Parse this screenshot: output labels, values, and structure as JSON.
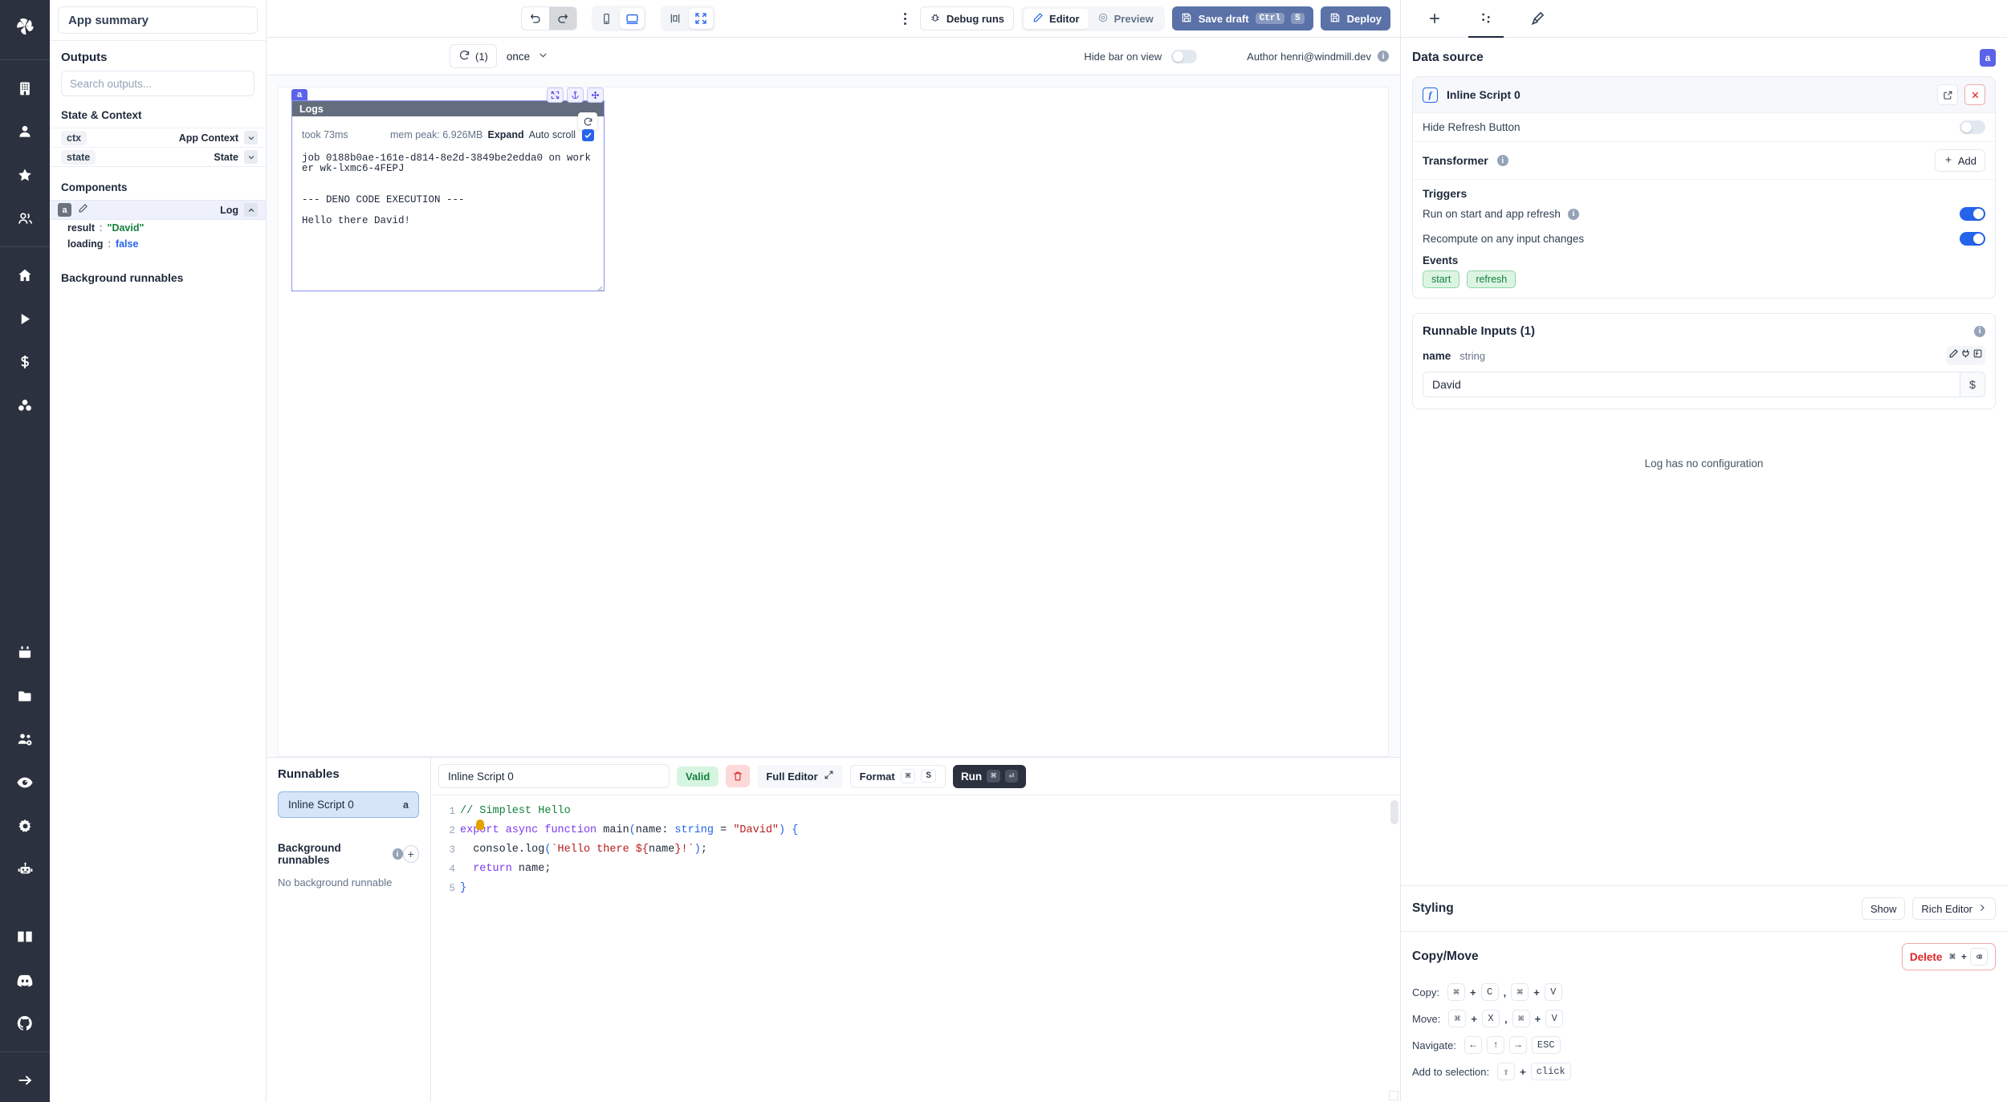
{
  "rail": {
    "logo_icon": "windmill-logo-icon",
    "group1": [
      "building-icon",
      "user-icon",
      "star-icon",
      "users-group-icon"
    ],
    "group2": [
      "home-icon",
      "play-icon",
      "dollar-icon",
      "blocks-icon"
    ],
    "group3": [
      "calendar-icon",
      "folder-icon",
      "team-settings-icon",
      "eye-icon",
      "gear-icon",
      "robot-icon"
    ],
    "group4": [
      "book-icon",
      "discord-icon",
      "github-icon"
    ],
    "footer": [
      "arrow-right-icon"
    ]
  },
  "left_panel": {
    "app_title": "App summary",
    "outputs_heading": "Outputs",
    "search_placeholder": "Search outputs...",
    "search_value": "",
    "state_context_heading": "State & Context",
    "state_rows": [
      {
        "key": "ctx",
        "value": "App Context"
      },
      {
        "key": "state",
        "value": "State"
      }
    ],
    "components_heading": "Components",
    "component": {
      "badge": "a",
      "name": "Log",
      "edit_icon": "pencil-icon",
      "collapse_icon": "chevron-up-icon",
      "outputs": [
        {
          "key": "result",
          "sep": ":",
          "value": "\"David\"",
          "kind": "string"
        },
        {
          "key": "loading",
          "sep": ":",
          "value": "false",
          "kind": "boolean"
        }
      ]
    },
    "background_runnables_heading": "Background runnables"
  },
  "topbar": {
    "undo_icon": "undo-icon",
    "redo_icon": "redo-icon",
    "mobile_icon": "mobile-icon",
    "desktop_icon": "desktop-icon",
    "width_icon": "width-icon",
    "fullscreen_icon": "fullscreen-icon",
    "more_icon": "more-vertical-icon",
    "debug_runs": "Debug runs",
    "debug_icon": "bug-icon",
    "editor": "Editor",
    "editor_icon": "pencil-icon",
    "preview": "Preview",
    "preview_icon": "eye-icon",
    "save_draft": "Save draft",
    "save_icon": "save-icon",
    "save_key1": "Ctrl",
    "save_key2": "S",
    "deploy": "Deploy",
    "deploy_icon": "save-icon"
  },
  "subbar": {
    "refresh_icon": "refresh-icon",
    "refresh_count": "(1)",
    "mode": "once",
    "mode_chevron": "chevron-down-icon",
    "hide_bar_label": "Hide bar on view",
    "hide_bar_on": false,
    "author": "Author henri@windmill.dev",
    "info_icon": "info-icon"
  },
  "logs_card": {
    "badge": "a",
    "title": "Logs",
    "tools": [
      "fullscreen-icon",
      "anchor-icon",
      "move-icon"
    ],
    "refresh_icon": "refresh-icon",
    "took": "took 73ms",
    "mem_peak": "mem peak: 6.926MB",
    "expand": "Expand",
    "auto_scroll": "Auto scroll",
    "auto_scroll_checked": true,
    "checkbox_icon": "check-icon",
    "log_lines": [
      "job 0188b0ae-161e-d814-8e2d-3849be2edda0 on worker wk-lxmc6-4FEPJ",
      "",
      "",
      "--- DENO CODE EXECUTION ---",
      "",
      "Hello there David!"
    ]
  },
  "runnables": {
    "heading": "Runnables",
    "items": [
      {
        "name": "Inline Script 0",
        "badge": "a"
      }
    ],
    "background_heading": "Background runnables",
    "info_icon": "info-icon",
    "add_icon": "plus-icon",
    "empty_text": "No background runnable"
  },
  "editor": {
    "script_name": "Inline Script 0",
    "valid_badge": "Valid",
    "delete_icon": "trash-icon",
    "full_editor": "Full Editor",
    "full_editor_icon": "expand-diagonal-icon",
    "format": "Format",
    "format_key1": "⌘",
    "format_key2": "S",
    "run": "Run",
    "run_key1": "⌘",
    "run_key2": "⏎",
    "line_numbers": [
      "1",
      "2",
      "3",
      "4",
      "5"
    ],
    "code_lines": [
      {
        "n": 1,
        "tokens": [
          {
            "t": "// Simplest Hello",
            "c": "c-cm"
          }
        ]
      },
      {
        "n": 2,
        "tokens": [
          {
            "t": "export",
            "c": "c-kw"
          },
          {
            "t": " ",
            "c": "c-pl"
          },
          {
            "t": "async",
            "c": "c-kw"
          },
          {
            "t": " ",
            "c": "c-pl"
          },
          {
            "t": "function",
            "c": "c-kw"
          },
          {
            "t": " ",
            "c": "c-pl"
          },
          {
            "t": "main",
            "c": "c-fn"
          },
          {
            "t": "(",
            "c": "c-ty"
          },
          {
            "t": "name",
            "c": "c-pl"
          },
          {
            "t": ": ",
            "c": "c-pl"
          },
          {
            "t": "string",
            "c": "c-ty"
          },
          {
            "t": " = ",
            "c": "c-pl"
          },
          {
            "t": "\"David\"",
            "c": "c-st"
          },
          {
            "t": ") {",
            "c": "c-ty"
          }
        ]
      },
      {
        "n": 3,
        "tokens": [
          {
            "t": "  console",
            "c": "c-pl"
          },
          {
            "t": ".",
            "c": "c-pl"
          },
          {
            "t": "log",
            "c": "c-pl"
          },
          {
            "t": "(",
            "c": "c-ty"
          },
          {
            "t": "`Hello there ${",
            "c": "c-st"
          },
          {
            "t": "name",
            "c": "c-pl"
          },
          {
            "t": "}!`",
            "c": "c-st"
          },
          {
            "t": ")",
            "c": "c-ty"
          },
          {
            "t": ";",
            "c": "c-pl"
          }
        ]
      },
      {
        "n": 4,
        "tokens": [
          {
            "t": "  ",
            "c": "c-pl"
          },
          {
            "t": "return",
            "c": "c-kw"
          },
          {
            "t": " name;",
            "c": "c-pl"
          }
        ]
      },
      {
        "n": 5,
        "tokens": [
          {
            "t": "}",
            "c": "c-ty"
          }
        ]
      }
    ]
  },
  "right_panel": {
    "tabs": [
      {
        "icon": "plus-icon",
        "on": false
      },
      {
        "icon": "components-icon",
        "on": true
      },
      {
        "icon": "paintbrush-icon",
        "on": false
      }
    ],
    "data_source": {
      "heading": "Data source",
      "badge": "a",
      "script_name": "Inline Script 0",
      "script_icon": "function-icon",
      "open_icon": "external-link-icon",
      "remove_icon": "x-icon",
      "hide_refresh_label": "Hide Refresh Button",
      "hide_refresh_on": false
    },
    "transformer": {
      "heading": "Transformer",
      "info_icon": "info-icon",
      "add_label": "Add",
      "add_icon": "plus-icon"
    },
    "triggers": {
      "heading": "Triggers",
      "rows": [
        {
          "label": "Run on start and app refresh",
          "info": true,
          "on": true
        },
        {
          "label": "Recompute on any input changes",
          "info": false,
          "on": true
        }
      ],
      "events_label": "Events",
      "events": [
        "start",
        "refresh"
      ]
    },
    "runnable_inputs": {
      "heading": "Runnable Inputs (1)",
      "info_icon": "info-icon",
      "field_name": "name",
      "field_type": "string",
      "modes": [
        {
          "icon": "pencil-icon",
          "on": true
        },
        {
          "icon": "plug-icon",
          "on": false
        },
        {
          "icon": "function-icon",
          "on": false
        }
      ],
      "value": "David",
      "dollar_icon": "dollar-icon"
    },
    "no_config": "Log has no configuration",
    "styling": {
      "heading": "Styling",
      "show": "Show",
      "rich_editor": "Rich Editor",
      "chevron_icon": "chevron-right-icon"
    },
    "copy_move": {
      "heading": "Copy/Move",
      "delete_label": "Delete",
      "delete_key1": "⌘ +",
      "delete_key2": "⌫",
      "rows": [
        {
          "label": "Copy:",
          "keys": [
            "⌘",
            "+",
            "C",
            ",",
            "⌘",
            "+",
            "V"
          ]
        },
        {
          "label": "Move:",
          "keys": [
            "⌘",
            "+",
            "X",
            ",",
            "⌘",
            "+",
            "V"
          ]
        },
        {
          "label": "Navigate:",
          "keys": [
            "←",
            "↑",
            "→",
            "ESC"
          ]
        },
        {
          "label": "Add to selection:",
          "keys": [
            "⇧",
            "+",
            "click"
          ]
        }
      ]
    }
  },
  "colors": {
    "accent_blue": "#2563eb",
    "indigo": "#5b63e8",
    "deploy_blue": "#5b72a8",
    "danger": "#dc2626",
    "success": "#15803d",
    "rail_bg": "#2b313e"
  }
}
